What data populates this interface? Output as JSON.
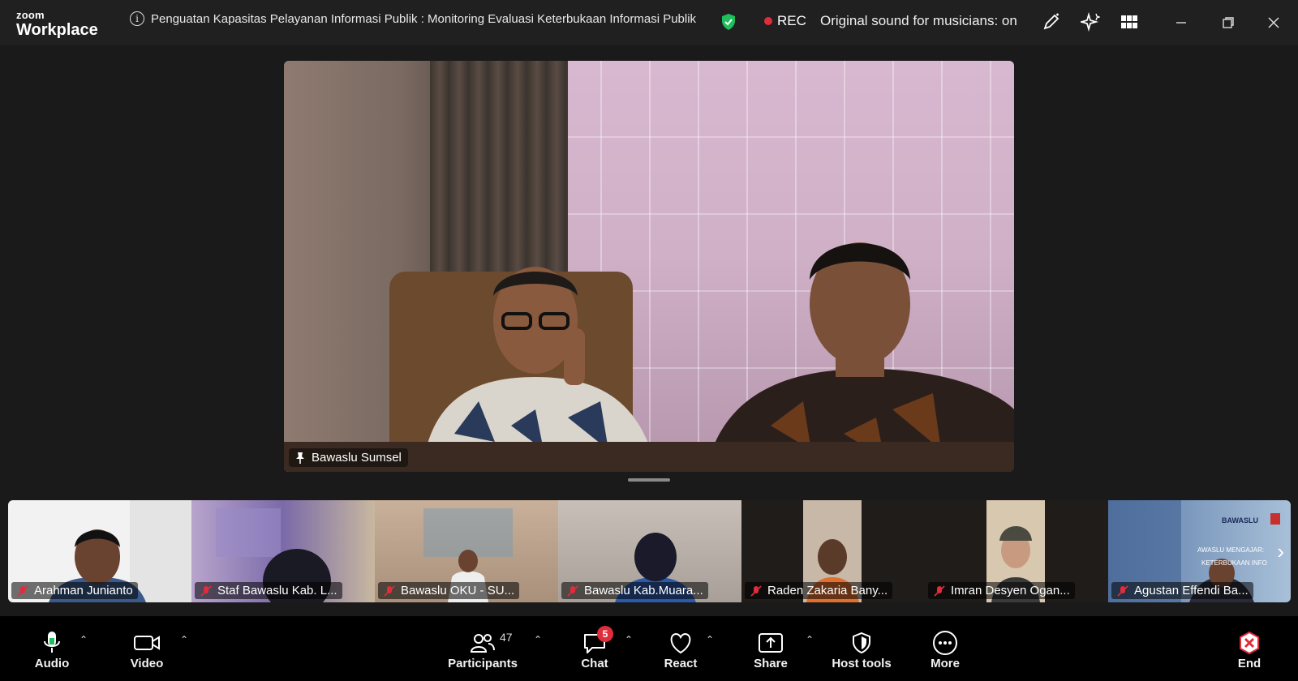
{
  "app": {
    "logo_small": "zoom",
    "logo_big": "Workplace"
  },
  "header": {
    "meeting_title": "Penguatan Kapasitas Pelayanan Informasi Publik : Monitoring Evaluasi Keterbukaan Informasi Publik",
    "recording_label": "REC",
    "original_sound": "Original sound for musicians: on",
    "icons": [
      "info-icon",
      "encryption-shield-icon",
      "annotate-icon",
      "ai-companion-icon",
      "grid-view-icon",
      "minimize-icon",
      "restore-icon",
      "close-icon"
    ]
  },
  "main_video": {
    "name": "Bawaslu Sumsel",
    "pinned": true
  },
  "participants_strip": [
    {
      "name": "Arahman Junianto",
      "muted": true
    },
    {
      "name": "Staf Bawaslu Kab. L...",
      "muted": true
    },
    {
      "name": "Bawaslu OKU - SU...",
      "muted": true
    },
    {
      "name": "Bawaslu Kab.Muara...",
      "muted": true
    },
    {
      "name": "Raden Zakaria Bany...",
      "muted": true
    },
    {
      "name": "Imran Desyen Ogan...",
      "muted": true
    },
    {
      "name": "Agustan Effendi Ba...",
      "muted": true
    }
  ],
  "thumb_text": {
    "brand": "BAWASLU",
    "slide_heading_1": "AWASLU MENGAJAR:",
    "slide_heading_2": "KETERBUKAAN INFO"
  },
  "toolbar": {
    "audio": "Audio",
    "video": "Video",
    "participants": "Participants",
    "participants_count": "47",
    "chat": "Chat",
    "chat_badge": "5",
    "react": "React",
    "share": "Share",
    "host_tools": "Host tools",
    "more": "More",
    "end": "End"
  },
  "colors": {
    "background": "#1a1a1a",
    "titlebar": "#202020",
    "toolbar": "#000000",
    "rec_red": "#e02d3c",
    "shield_green": "#1fbf5c"
  }
}
